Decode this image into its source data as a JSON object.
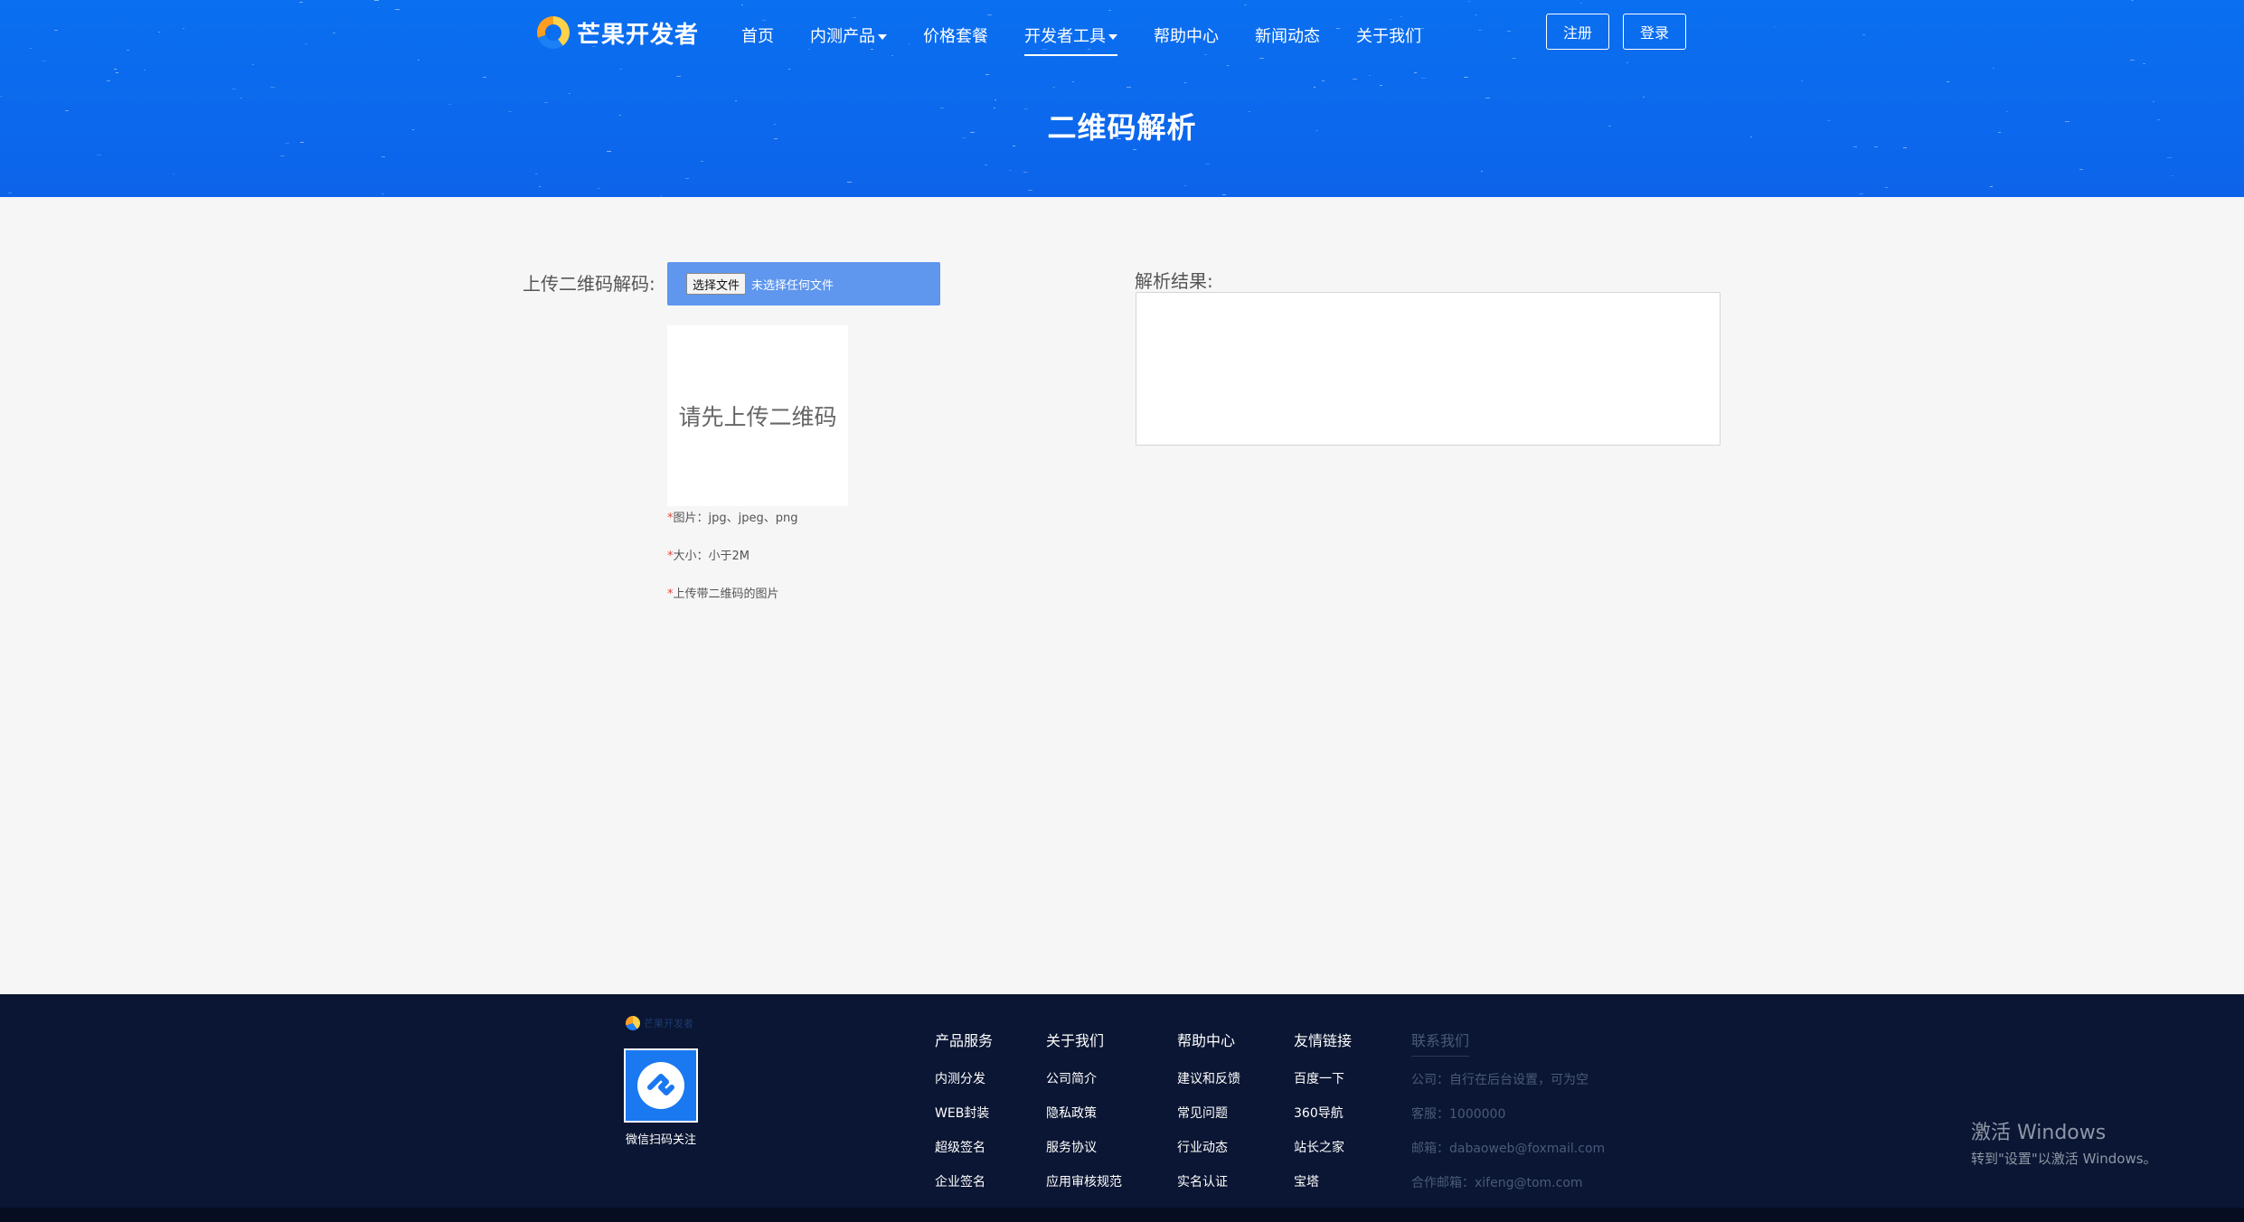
{
  "header": {
    "logo_text": "芒果开发者",
    "nav": [
      {
        "label": "首页",
        "dropdown": false,
        "active": false
      },
      {
        "label": "内测产品",
        "dropdown": true,
        "active": false
      },
      {
        "label": "价格套餐",
        "dropdown": false,
        "active": false
      },
      {
        "label": "开发者工具",
        "dropdown": true,
        "active": true
      },
      {
        "label": "帮助中心",
        "dropdown": false,
        "active": false
      },
      {
        "label": "新闻动态",
        "dropdown": false,
        "active": false
      },
      {
        "label": "关于我们",
        "dropdown": false,
        "active": false
      }
    ],
    "register_label": "注册",
    "login_label": "登录",
    "page_title": "二维码解析"
  },
  "main": {
    "upload_label": "上传二维码解码:",
    "file_button_label": "选择文件",
    "file_status": "未选择任何文件",
    "preview_placeholder": "请先上传二维码",
    "notes": [
      "图片：jpg、jpeg、png",
      "大小：小于2M",
      "上传带二维码的图片"
    ],
    "result_label": "解析结果:",
    "result_value": ""
  },
  "footer": {
    "logo_text": "芒果开发者",
    "qr_caption": "微信扫码关注",
    "columns": [
      {
        "title": "产品服务",
        "links": [
          "内测分发",
          "WEB封装",
          "超级签名",
          "企业签名"
        ]
      },
      {
        "title": "关于我们",
        "links": [
          "公司简介",
          "隐私政策",
          "服务协议",
          "应用审核规范"
        ]
      },
      {
        "title": "帮助中心",
        "links": [
          "建议和反馈",
          "常见问题",
          "行业动态",
          "实名认证"
        ]
      },
      {
        "title": "友情链接",
        "links": [
          "百度一下",
          "360导航",
          "站长之家",
          "宝塔"
        ]
      }
    ],
    "contact": {
      "title": "联系我们",
      "lines": [
        "公司：自行在后台设置，可为空",
        "客服：1000000",
        "邮箱：dabaoweb@foxmail.com",
        "合作邮箱：xifeng@tom.com"
      ]
    }
  },
  "watermark": {
    "title": "激活 Windows",
    "subtitle": "转到\"设置\"以激活 Windows。"
  },
  "colors": {
    "hero_blue": "#0a6ff0",
    "file_bar": "#5f96ee",
    "footer_bg": "#0a1633",
    "required_star": "#e0483a"
  }
}
